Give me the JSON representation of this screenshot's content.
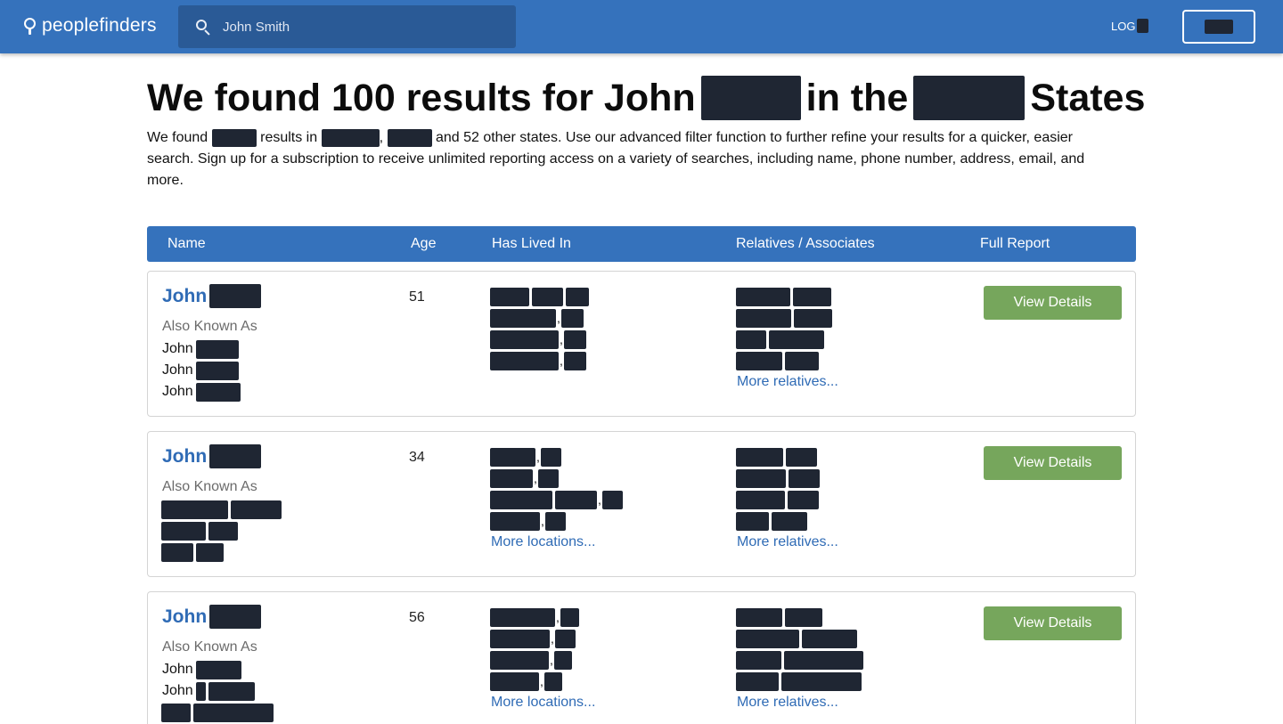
{
  "header": {
    "logo_text": "peoplefinders",
    "search_placeholder": "John Smith",
    "login_label": "LOG"
  },
  "heading": {
    "part1": "We found 100 results for John",
    "part2": "in the",
    "part3": "States"
  },
  "description": {
    "a": "We found",
    "b": "results in",
    "c": ",",
    "d": "and 52 other states. Use our advanced filter function to further refine your results for a quicker, easier search. Sign up for a subscription to receive unlimited reporting access on a variety of searches, including name, phone number, address, email, and more."
  },
  "table": {
    "columns": [
      "Name",
      "Age",
      "Has Lived In",
      "Relatives / Associates",
      "Full Report"
    ]
  },
  "results": [
    {
      "first_name": "John",
      "aka_label": "Also Known As",
      "aka_first_names": [
        "John",
        "John",
        "John"
      ],
      "age": "51",
      "more_locations": "",
      "more_relatives": "More relatives...",
      "button": "View Details"
    },
    {
      "first_name": "John",
      "aka_label": "Also Known As",
      "age": "34",
      "more_locations": "More locations...",
      "more_relatives": "More relatives...",
      "button": "View Details"
    },
    {
      "first_name": "John",
      "aka_label": "Also Known As",
      "aka_first_names": [
        "John",
        "John"
      ],
      "age": "56",
      "more_locations": "More locations...",
      "more_relatives": "More relatives...",
      "button": "View Details"
    }
  ],
  "colors": {
    "brand_blue": "#3572bc",
    "link_blue": "#2f6bb5",
    "button_green": "#76a65c",
    "redaction": "#1f2633"
  }
}
